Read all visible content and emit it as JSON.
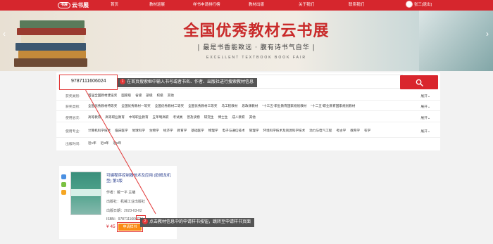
{
  "nav": {
    "logo_badge": "书展",
    "logo_text": "云书展",
    "items": [
      "首页",
      "教材巡展",
      "样书申请排行榜",
      "教材出版",
      "关于我们",
      "联系我们"
    ],
    "user": "张三[退出]"
  },
  "banner": {
    "title": "全国优秀教材云书展",
    "subtitle": "| 最是书香能致远 · 腹有诗书气自华 |",
    "english": "EXCELLENT TEXTBOOK BOOK FAIR",
    "prev_arrow": "‹",
    "next_arrow": "›"
  },
  "search": {
    "value": "9787111606024",
    "tip1_num": "1",
    "tip1": "在首页搜索框中输入书号或者书名、作者、出版社进行搜索教材信息"
  },
  "filters": [
    {
      "label": "获奖类别:",
      "options": [
        "首届全国教材建设奖",
        "国家级",
        "省级",
        "部级",
        "校级",
        "其他"
      ],
      "expand": "展开"
    },
    {
      "label": "获奖类别:",
      "options": [
        "全国优秀教材特等奖",
        "全国优秀教材一等奖",
        "全国优秀教材二等奖",
        "全国优秀教材三等奖",
        "马工程教材",
        "思政课教材",
        "\"十三五\"职业教育国家规划教材",
        "\"十二五\"职业教育国家规划教材"
      ],
      "expand": "展开"
    },
    {
      "label": "使用层次:",
      "options": [
        "高等教育",
        "高等职业教育",
        "中等职业教育",
        "五年制高职",
        "考试类",
        "普及读物",
        "研究生",
        "博士生",
        "成人教育",
        "其他"
      ],
      "expand": "展开"
    },
    {
      "label": "使用专业:",
      "options": [
        "计算机科学技术",
        "临床医学",
        "地球科学",
        "生物学",
        "经济学",
        "教育学",
        "基础医学",
        "物理学",
        "电子与通信技术",
        "管理学",
        "环境科学技术及资源科学技术",
        "动力与电气工程",
        "考古学",
        "教育学",
        "农学"
      ],
      "expand": "展开"
    },
    {
      "label": "出版时间:",
      "options": [
        "近1年",
        "近3年",
        "近5年"
      ],
      "expand": ""
    }
  ],
  "book": {
    "title": "可编程序控制器技术及应用 (欧姆龙机型) 第3版",
    "author": "作者：戴一平 主编",
    "publisher": "出版社：机械工业出版社",
    "date": "出版日期：2023-03-02",
    "isbn": "ISBN：9787111606024",
    "price": "¥ 45",
    "apply": "申请样书",
    "tip2_num": "2",
    "tip2": "点击教材信息中的申请样书按钮，跳转至申请样书页面"
  },
  "colors": {
    "brand": "#d6262d",
    "apply": "#fa8c16",
    "annotation": "#e23737"
  }
}
